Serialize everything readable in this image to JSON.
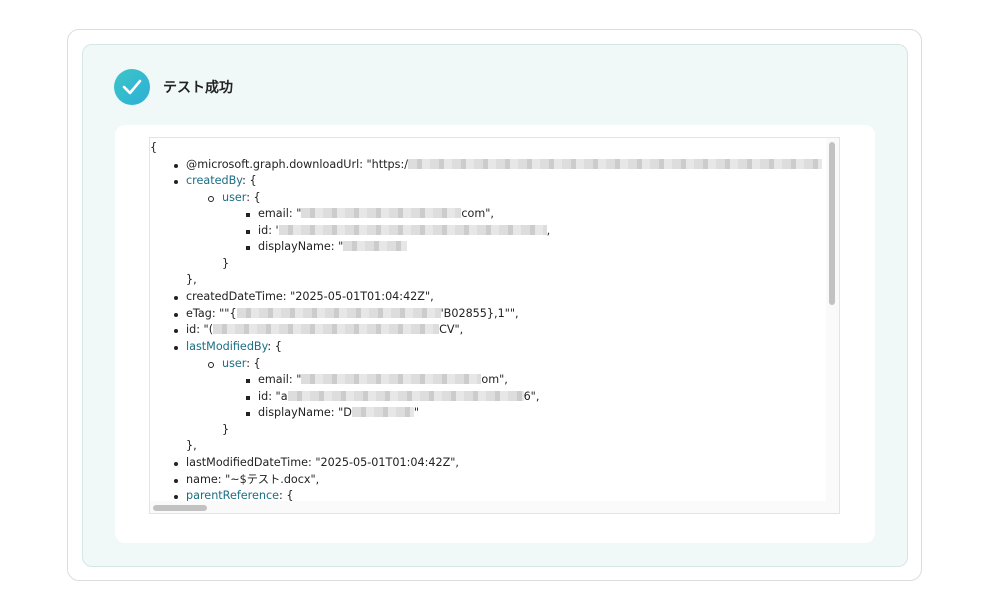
{
  "header": {
    "title": "テスト成功",
    "icon": "check-circle-icon",
    "accent": "#36bdd0"
  },
  "json_viewer": {
    "open_brace": "{",
    "lines": {
      "download_url": {
        "key": "@microsoft.graph.downloadUrl",
        "value_prefix": "\"https:/"
      },
      "created_by": {
        "key": "createdBy",
        "open": "{",
        "close": "},"
      },
      "created_user": {
        "key": "user",
        "open": "{",
        "close": "}"
      },
      "created_email": {
        "key": "email",
        "prefix": "\"",
        "suffix": "com\","
      },
      "created_id": {
        "key": "id",
        "prefix": "'",
        "suffix": ","
      },
      "created_name": {
        "key": "displayName",
        "prefix": "\"",
        "suffix": ""
      },
      "created_datetime": {
        "key": "createdDateTime",
        "value": "\"2025-05-01T01:04:42Z\","
      },
      "etag": {
        "key": "eTag",
        "prefix": "\"\"{",
        "suffix": "'B02855},1\"\","
      },
      "id": {
        "key": "id",
        "prefix": "\"(",
        "suffix": "CV\","
      },
      "last_modified_by": {
        "key": "lastModifiedBy",
        "open": "{",
        "close": "},"
      },
      "modified_user": {
        "key": "user",
        "open": "{",
        "close": "}"
      },
      "modified_email": {
        "key": "email",
        "prefix": "\"",
        "suffix": "om\","
      },
      "modified_id": {
        "key": "id",
        "prefix": "\"a",
        "suffix": "6\","
      },
      "modified_name": {
        "key": "displayName",
        "prefix": "\"D",
        "suffix": "\""
      },
      "last_modified_datetime": {
        "key": "lastModifiedDateTime",
        "value": "\"2025-05-01T01:04:42Z\","
      },
      "name": {
        "key": "name",
        "value": "\"~$テスト.docx\","
      },
      "parent_reference": {
        "key": "parentReference",
        "open": "{"
      }
    }
  },
  "colors": {
    "key_link": "#1a6e84",
    "panel_bg": "#f1f8f8"
  }
}
